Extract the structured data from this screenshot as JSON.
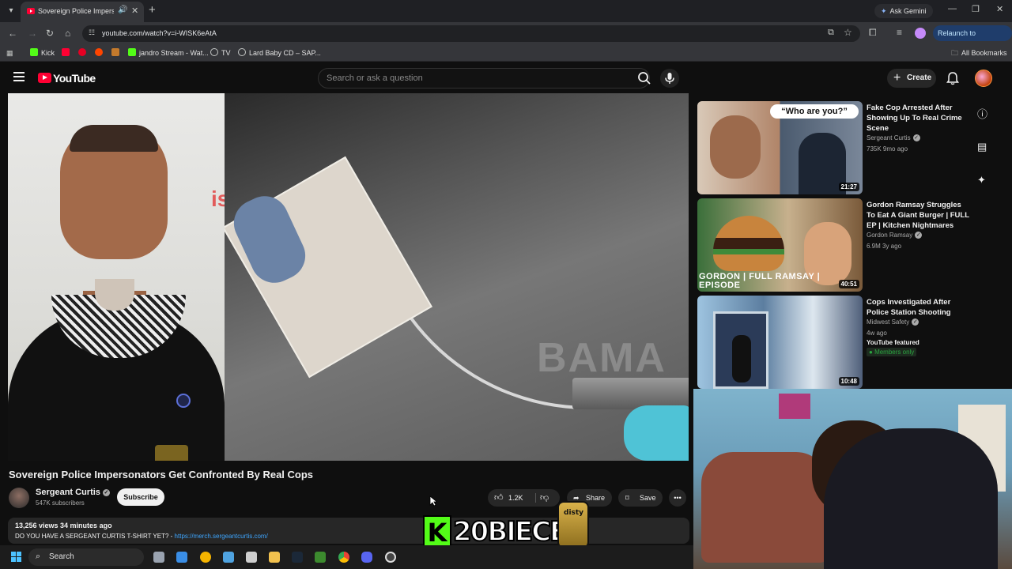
{
  "browser": {
    "tab": {
      "title": "Sovereign Police Impersonat"
    },
    "gemini_label": "Ask Gemini",
    "url": "youtube.com/watch?v=i-WISK6eAtA",
    "relaunch_label": "Relaunch to update",
    "bookmarks": [
      {
        "label": "Kick",
        "color": "#53fc18"
      },
      {
        "label": "",
        "color": "#ff0033"
      },
      {
        "label": "",
        "color": "#e60023"
      },
      {
        "label": "",
        "color": "#ff4500"
      },
      {
        "label": "",
        "color": "#c47a2c"
      },
      {
        "label": "jandro Stream - Wat...",
        "color": "#53fc18"
      },
      {
        "label": "TV",
        "color": "#c4c7c5"
      },
      {
        "label": "Lard Baby CD – SAP...",
        "color": "#c4c7c5"
      }
    ],
    "all_bookmarks": "All Bookmarks"
  },
  "youtube": {
    "logo": "YouTube",
    "search_placeholder": "Search or ask a question",
    "create_label": "Create"
  },
  "video": {
    "title": "Sovereign Police Impersonators Get Confronted By Real Cops",
    "watermark_text": "BAMA",
    "channel": "Sergeant Curtis",
    "subscribers": "547K subscribers",
    "subscribe_label": "Subscribe",
    "likes": "1.2K",
    "share_label": "Share",
    "save_label": "Save",
    "views_age": "13,256 views  34 minutes ago",
    "desc_text": "DO YOU HAVE A SERGEANT CURTIS T-SHIRT YET? - ",
    "desc_link": "https://merch.sergeantcurtis.com/"
  },
  "recommendations": [
    {
      "title": "Fake Cop Arrested After Showing Up To Real Crime Scene",
      "channel": "Sergeant Curtis",
      "meta": "735K  9mo ago",
      "duration": "21:27",
      "thumb_text": "“Who are you?”"
    },
    {
      "title": "Gordon Ramsay Struggles To Eat A Giant Burger | FULL EP | Kitchen Nightmares",
      "channel": "Gordon Ramsay",
      "meta": "6.9M  3y ago",
      "duration": "40:51",
      "thumb_text": "GORDON | FULL RAMSAY | EPISODE"
    },
    {
      "title": "Cops Investigated After Police Station Shooting",
      "channel": "Midwest Safety",
      "meta": "4w ago",
      "featured": "YouTube featured",
      "members": "Members only",
      "duration": "10:48"
    }
  ],
  "overlay": {
    "kick_letter": "K",
    "kick_name": "20BIECE",
    "can_label": "disty"
  },
  "taskbar": {
    "search_label": "Search"
  }
}
